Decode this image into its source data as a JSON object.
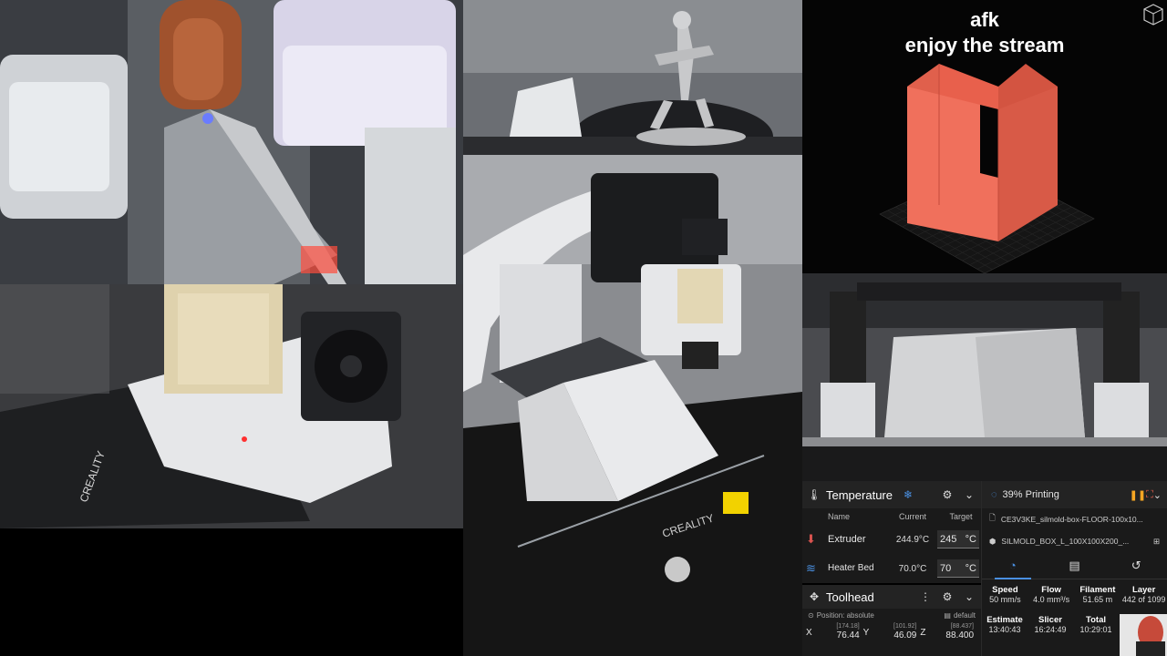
{
  "overlay": {
    "line1": "afk",
    "line2": "enjoy the stream"
  },
  "temperature": {
    "title": "Temperature",
    "col_name": "Name",
    "col_current": "Current",
    "col_target": "Target",
    "rows": [
      {
        "name": "Extruder",
        "current": "244.9°C",
        "target": "245",
        "unit": "°C"
      },
      {
        "name": "Heater Bed",
        "current": "70.0°C",
        "target": "70",
        "unit": "°C"
      }
    ]
  },
  "toolhead": {
    "title": "Toolhead",
    "position_mode": "Position: absolute",
    "profile": "default",
    "x_label": "X",
    "x_commanded": "[174.18]",
    "x_value": "76.44",
    "y_label": "Y",
    "y_commanded": "[101.92]",
    "y_value": "46.09",
    "z_label": "Z",
    "z_commanded": "[88.437]",
    "z_value": "88.400"
  },
  "status": {
    "progress_text": "39% Printing",
    "file1": "CE3V3KE_silmold-box-FLOOR-100x10...",
    "file2": "SILMOLD_BOX_L_100X100X200_...",
    "speed_label": "Speed",
    "speed_value": "50 mm/s",
    "flow_label": "Flow",
    "flow_value": "4.0 mm³/s",
    "filament_label": "Filament",
    "filament_value": "51.65 m",
    "layer_label": "Layer",
    "layer_value": "442 of 1099",
    "estimate_label": "Estimate",
    "estimate_value": "13:40:43",
    "slicer_label": "Slicer",
    "slicer_value": "16:24:49",
    "total_label": "Total",
    "total_value": "10:29:01"
  },
  "colors": {
    "accent_blue": "#4a90e2",
    "pause_orange": "#f5a623",
    "model_red": "#e8604c",
    "extruder_red": "#d9534f"
  }
}
